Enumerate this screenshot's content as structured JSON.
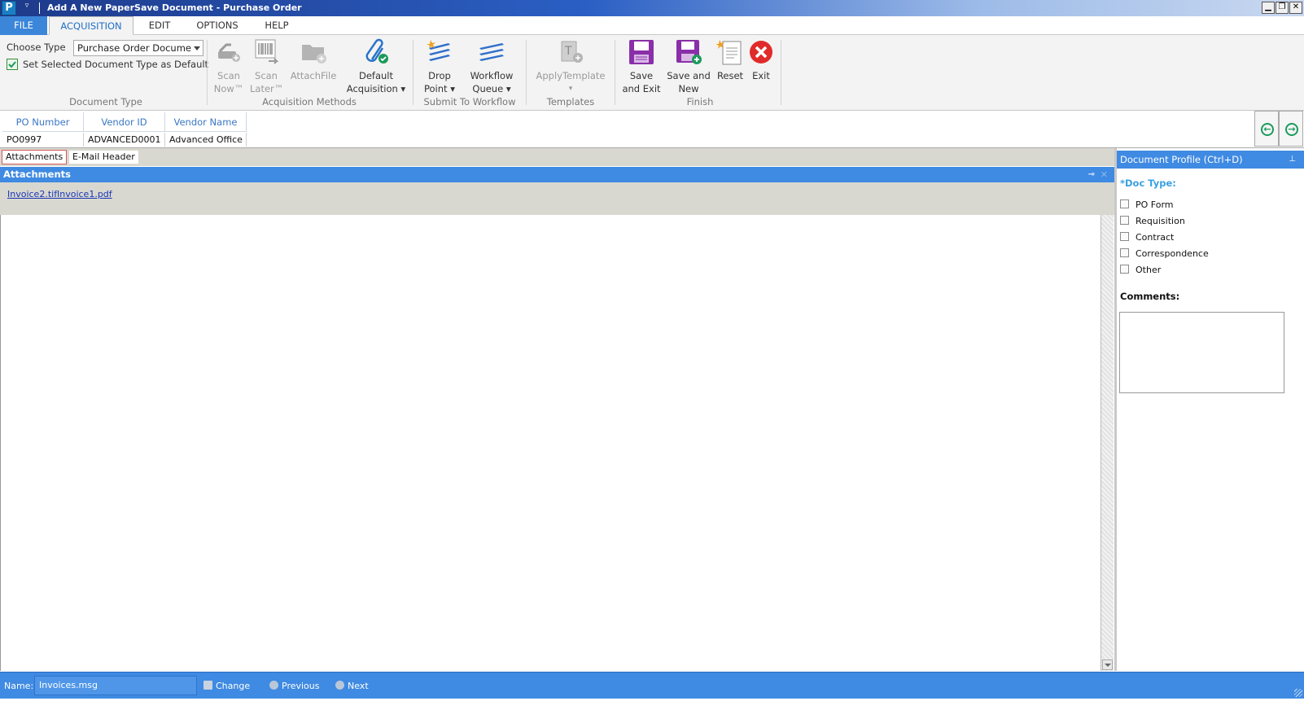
{
  "window": {
    "title": "Add A New PaperSave Document - Purchase Order",
    "logo": "P",
    "qat_glyph": "▿",
    "minimize": "▁",
    "restore": "❐",
    "close": "✕"
  },
  "ribbon": {
    "tabs": [
      "FILE",
      "ACQUISITION",
      "EDIT",
      "OPTIONS",
      "HELP"
    ],
    "active_tab": "ACQUISITION",
    "document_type": {
      "choose_label": "Choose Type",
      "selected": "Purchase Order Docume",
      "set_default_label": "Set Selected Document Type as Default",
      "group_label": "Document Type"
    },
    "acquisition": {
      "scan_now": [
        "Scan",
        "Now™"
      ],
      "scan_later": [
        "Scan",
        "Later™"
      ],
      "attach_file": "AttachFile",
      "default_acquisition": [
        "Default",
        "Acquisition ▾"
      ],
      "group_label": "Acquisition Methods"
    },
    "workflow": {
      "drop_point": [
        "Drop",
        "Point ▾"
      ],
      "workflow_queue": [
        "Workflow",
        "Queue ▾"
      ],
      "group_label": "Submit To Workflow"
    },
    "templates": {
      "apply_template": "ApplyTemplate",
      "apply_template_arrow": "▾",
      "group_label": "Templates"
    },
    "finish": {
      "save_exit": [
        "Save",
        "and Exit"
      ],
      "save_new": [
        "Save and",
        "New"
      ],
      "reset": "Reset",
      "exit": "Exit",
      "group_label": "Finish"
    }
  },
  "index_grid": {
    "headers": [
      "PO Number",
      "Vendor ID",
      "Vendor Name"
    ],
    "row": [
      "PO0997",
      "ADVANCED0001",
      "Advanced Office S"
    ],
    "nav_prev": "←",
    "nav_next": "→"
  },
  "doc_tabs": [
    "Attachments",
    "E-Mail Header"
  ],
  "attachments": {
    "header": "Attachments",
    "pin": "⊸",
    "close": "✕",
    "files": [
      "Invoice2.tif",
      "Invoice1.pdf"
    ]
  },
  "profile": {
    "header": "Document Profile (Ctrl+D)",
    "pin": "⊥",
    "doc_type_label": "*Doc Type:",
    "doc_types": [
      "PO Form",
      "Requisition",
      "Contract",
      "Correspondence",
      "Other"
    ],
    "comments_label": "Comments:"
  },
  "statusbar": {
    "name_label": "Name:",
    "name_value": "Invoices.msg",
    "change": "Change",
    "previous": "Previous",
    "next": "Next"
  },
  "colors": {
    "accent": "#3f8ae2",
    "file_tab": "#3b86d9",
    "exit_red": "#e02b2b",
    "save_purple": "#8a2fa8",
    "nav_green": "#1c9a5c"
  }
}
